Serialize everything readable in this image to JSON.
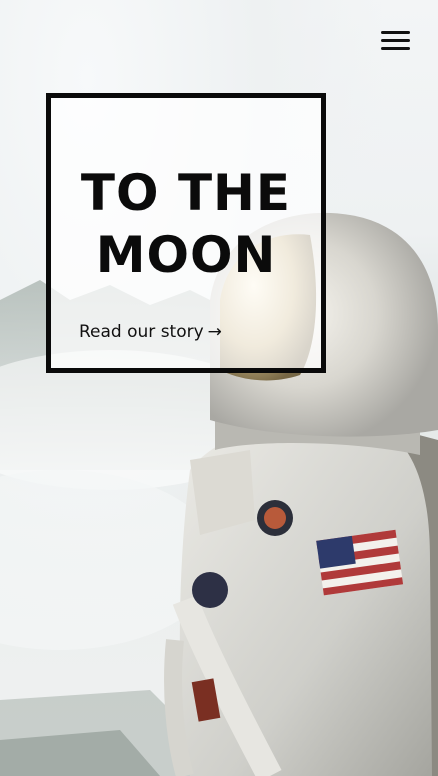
{
  "hero": {
    "title_line1": "TO THE",
    "title_line2": "MOON",
    "cta_label": "Read our story",
    "cta_arrow": "→",
    "image_alt": "astronaut-photo"
  },
  "nav": {
    "menu_icon": "hamburger-icon"
  },
  "colors": {
    "text": "#0b0b0b",
    "card_border": "#0a0a0a",
    "suit": "#d9d9d6"
  }
}
